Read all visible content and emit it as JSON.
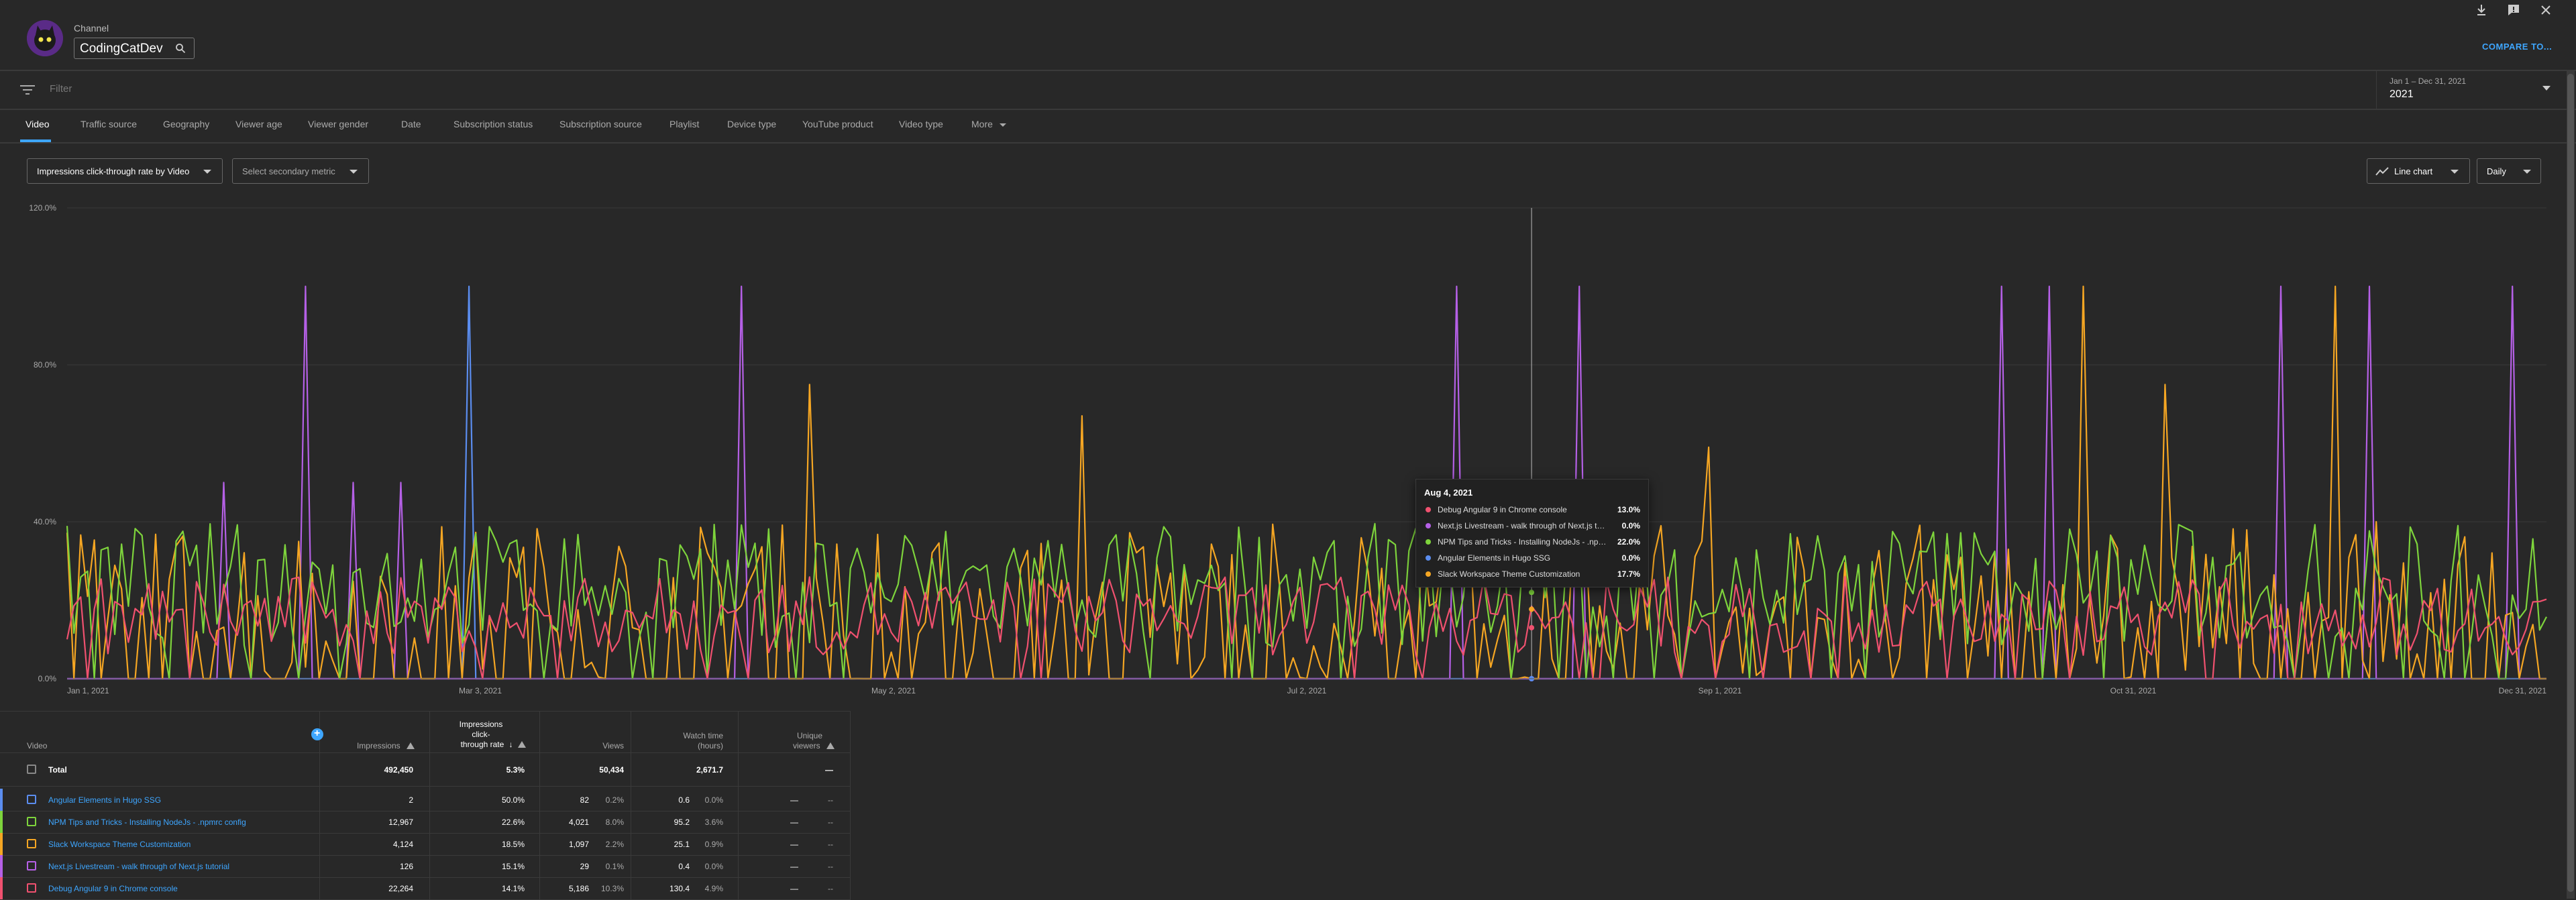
{
  "header": {
    "channel_label": "Channel",
    "channel_name": "CodingCatDev",
    "compare_label": "COMPARE TO..."
  },
  "filter": {
    "placeholder": "Filter"
  },
  "date": {
    "range": "Jan 1 – Dec 31, 2021",
    "year": "2021"
  },
  "tabs": [
    "Video",
    "Traffic source",
    "Geography",
    "Viewer age",
    "Viewer gender",
    "Date",
    "Subscription status",
    "Subscription source",
    "Playlist",
    "Device type",
    "YouTube product",
    "Video type",
    "More"
  ],
  "controls": {
    "primary_metric": "Impressions click-through rate by Video",
    "secondary_metric": "Select secondary metric",
    "chart_type": "Line chart",
    "granularity": "Daily"
  },
  "chart_data": {
    "type": "line",
    "x_start": "2021-01-01",
    "x_end": "2021-12-31",
    "x_ticks": [
      "Jan 1, 2021",
      "Mar 3, 2021",
      "May 2, 2021",
      "Jul 2, 2021",
      "Sep 1, 2021",
      "Oct 31, 2021",
      "Dec 31, 2021"
    ],
    "y_ticks": [
      "0.0%",
      "40.0%",
      "80.0%",
      "120.0%"
    ],
    "ylim": [
      0,
      120
    ],
    "grid": true,
    "series": [
      {
        "name": "Debug Angular 9 in Chrome console",
        "color": "#f0516f",
        "spikes": []
      },
      {
        "name": "Next.js Livestream - walk through of Next.js tutorial",
        "color": "#b560e6",
        "spikes": [
          [
            "2021-01-24",
            50
          ],
          [
            "2021-02-05",
            100
          ],
          [
            "2021-02-12",
            50
          ],
          [
            "2021-02-19",
            50
          ],
          [
            "2021-04-10",
            100
          ],
          [
            "2021-07-24",
            100
          ],
          [
            "2021-08-11",
            100
          ],
          [
            "2021-10-12",
            100
          ],
          [
            "2021-10-19",
            100
          ],
          [
            "2021-11-22",
            100
          ],
          [
            "2021-12-05",
            100
          ],
          [
            "2021-12-26",
            100
          ]
        ]
      },
      {
        "name": "NPM Tips and Tricks - Installing NodeJs - .npmrc config",
        "color": "#7ed43c",
        "spikes": []
      },
      {
        "name": "Angular Elements in Hugo SSG",
        "color": "#5b8def",
        "spikes": [
          [
            "2021-03-01",
            100
          ]
        ]
      },
      {
        "name": "Slack Workspace Theme Customization",
        "color": "#f5a623",
        "spikes": [
          [
            "2021-04-20",
            75
          ],
          [
            "2021-05-30",
            67
          ],
          [
            "2021-08-30",
            59
          ],
          [
            "2021-10-24",
            100
          ],
          [
            "2021-11-05",
            75
          ],
          [
            "2021-11-30",
            100
          ]
        ]
      }
    ],
    "tooltip": {
      "date": "Aug 4, 2021",
      "rows": [
        {
          "name": "Debug Angular 9 in Chrome console",
          "value": "13.0%",
          "color": "#f0516f"
        },
        {
          "name": "Next.js Livestream - walk through of Next.js tutorial",
          "value": "0.0%",
          "color": "#b560e6"
        },
        {
          "name": "NPM Tips and Tricks - Installing NodeJs - .npmrc config",
          "value": "22.0%",
          "color": "#7ed43c"
        },
        {
          "name": "Angular Elements in Hugo SSG",
          "value": "0.0%",
          "color": "#5b8def"
        },
        {
          "name": "Slack Workspace Theme Customization",
          "value": "17.7%",
          "color": "#f5a623"
        }
      ]
    }
  },
  "table": {
    "headers": {
      "video": "Video",
      "impressions": "Impressions",
      "ctr_1": "Impressions",
      "ctr_2": "click-",
      "ctr_3": "through rate",
      "views": "Views",
      "watch_1": "Watch time",
      "watch_2": "(hours)",
      "unique_1": "Unique",
      "unique_2": "viewers"
    },
    "total": {
      "label": "Total",
      "impressions": "492,450",
      "ctr": "5.3%",
      "views": "50,434",
      "watch": "2,671.7",
      "unique": "—"
    },
    "rows": [
      {
        "title": "Angular Elements in Hugo SSG",
        "color": "#5b8def",
        "impressions": "2",
        "ctr": "50.0%",
        "views": "82",
        "views_pct": "0.2%",
        "watch": "0.6",
        "watch_pct": "0.0%",
        "unique": "—",
        "unique_pct": "--"
      },
      {
        "title": "NPM Tips and Tricks - Installing NodeJs - .npmrc config",
        "color": "#7ed43c",
        "impressions": "12,967",
        "ctr": "22.6%",
        "views": "4,021",
        "views_pct": "8.0%",
        "watch": "95.2",
        "watch_pct": "3.6%",
        "unique": "—",
        "unique_pct": "--"
      },
      {
        "title": "Slack Workspace Theme Customization",
        "color": "#f5a623",
        "impressions": "4,124",
        "ctr": "18.5%",
        "views": "1,097",
        "views_pct": "2.2%",
        "watch": "25.1",
        "watch_pct": "0.9%",
        "unique": "—",
        "unique_pct": "--"
      },
      {
        "title": "Next.js Livestream - walk through of Next.js tutorial",
        "color": "#b560e6",
        "impressions": "126",
        "ctr": "15.1%",
        "views": "29",
        "views_pct": "0.1%",
        "watch": "0.4",
        "watch_pct": "0.0%",
        "unique": "—",
        "unique_pct": "--"
      },
      {
        "title": "Debug Angular 9 in Chrome console",
        "color": "#f0516f",
        "impressions": "22,264",
        "ctr": "14.1%",
        "views": "5,186",
        "views_pct": "10.3%",
        "watch": "130.4",
        "watch_pct": "4.9%",
        "unique": "—",
        "unique_pct": "--"
      }
    ]
  }
}
